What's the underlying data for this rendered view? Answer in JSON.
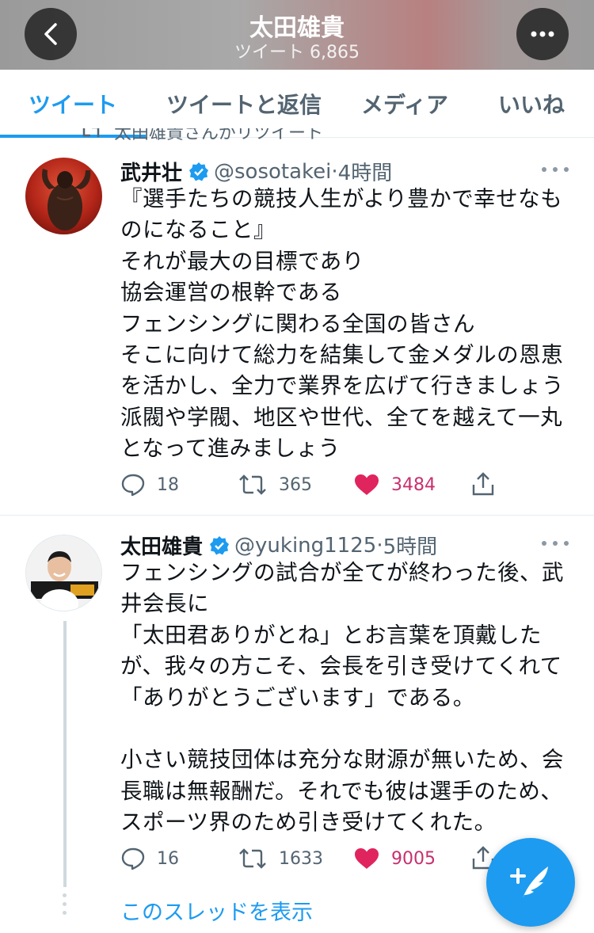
{
  "header": {
    "title": "太田雄貴",
    "subtitle": "ツイート 6,865"
  },
  "tabs": [
    {
      "label": "ツイート",
      "active": true
    },
    {
      "label": "ツイートと返信",
      "active": false
    },
    {
      "label": "メディア",
      "active": false
    },
    {
      "label": "いいね",
      "active": false
    }
  ],
  "retweet_context": {
    "text": "太田雄貴さんがリツイート"
  },
  "tweets": [
    {
      "name": "武井壮",
      "handle": "@sosotakei",
      "time": "4時間",
      "text": "『選手たちの競技人生がより豊かで幸せなものになること』\nそれが最大の目標であり\n協会運営の根幹である\nフェンシングに関わる全国の皆さん\nそこに向けて総力を結集して金メダルの恩恵を活かし、全力で業界を広げて行きましょう\n派閥や学閥、地区や世代、全てを越えて一丸となって進みましょう",
      "replies": "18",
      "retweets": "365",
      "likes": "3484"
    },
    {
      "name": "太田雄貴",
      "handle": "@yuking1125",
      "time": "5時間",
      "text": "フェンシングの試合が全てが終わった後、武井会長に\n「太田君ありがとね」とお言葉を頂戴したが、我々の方こそ、会長を引き受けてくれて「ありがとうございます」である。\n\n小さい競技団体は充分な財源が無いため、会長職は無報酬だ。それでも彼は選手のため、スポーツ界のため引き受けてくれた。",
      "replies": "16",
      "retweets": "1633",
      "likes": "9005"
    }
  ],
  "show_thread": "このスレッドを表示",
  "colors": {
    "accent": "#1d9bf0",
    "like": "#e0245e",
    "muted": "#536471"
  },
  "icons": [
    "back-arrow-icon",
    "more-icon",
    "verified-icon",
    "reply-icon",
    "retweet-icon",
    "heart-icon",
    "share-icon",
    "compose-icon"
  ]
}
